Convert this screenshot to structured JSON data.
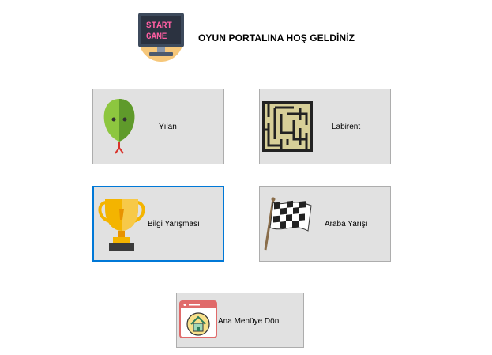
{
  "header": {
    "title": "OYUN PORTALINA HOŞ GELDİNİZ",
    "logo_text_line1": "START",
    "logo_text_line2": "GAME"
  },
  "buttons": [
    {
      "label": "Yılan",
      "icon": "snake-icon"
    },
    {
      "label": "Labirent",
      "icon": "maze-icon"
    },
    {
      "label": "Bilgi Yarışması",
      "icon": "trophy-icon"
    },
    {
      "label": "Araba Yarışı",
      "icon": "checkered-flag-icon"
    },
    {
      "label": "Ana Menüye Dön",
      "icon": "home-window-icon"
    }
  ],
  "colors": {
    "accent_focus": "#0078d7",
    "button_bg": "#e1e1e1",
    "button_border": "#adadad"
  }
}
